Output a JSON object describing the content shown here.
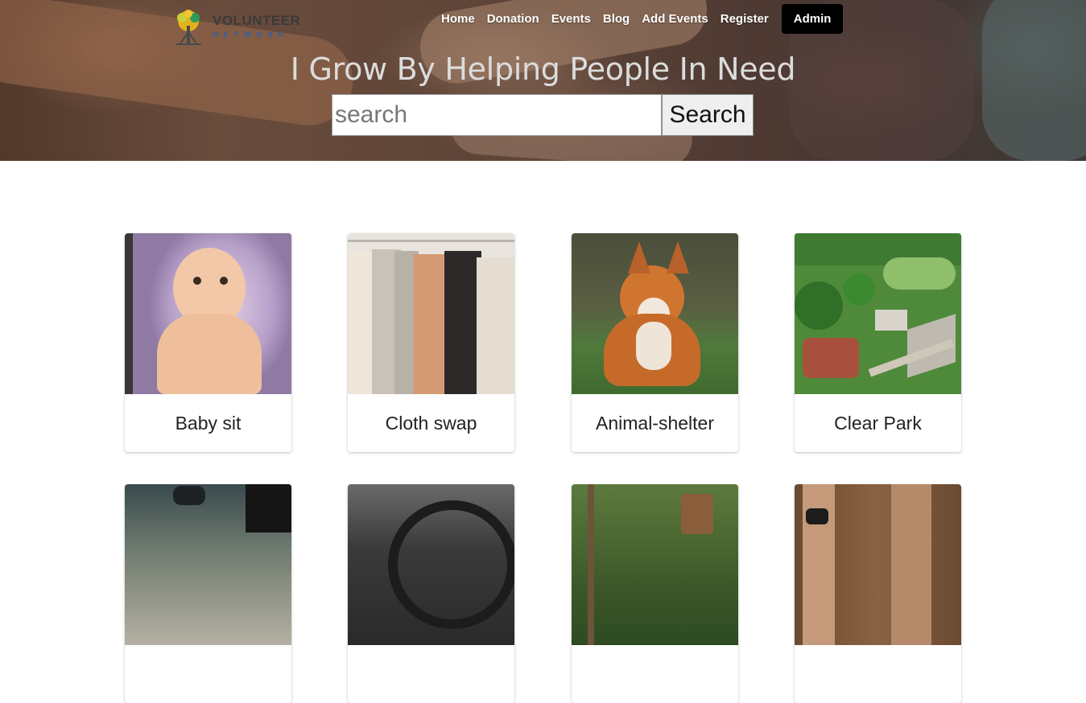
{
  "brand": {
    "name": "VOLUNTEER",
    "sub": "NETWORK"
  },
  "nav": {
    "links": [
      "Home",
      "Donation",
      "Events",
      "Blog",
      "Add Events",
      "Register"
    ],
    "admin_label": "Admin"
  },
  "hero": {
    "title": "I Grow By Helping People In Need",
    "search_placeholder": "search",
    "search_button": "Search"
  },
  "events": [
    {
      "title": "Baby sit"
    },
    {
      "title": "Cloth swap"
    },
    {
      "title": "Animal-shelter"
    },
    {
      "title": "Clear Park"
    },
    {
      "title": ""
    },
    {
      "title": ""
    },
    {
      "title": ""
    },
    {
      "title": ""
    }
  ]
}
